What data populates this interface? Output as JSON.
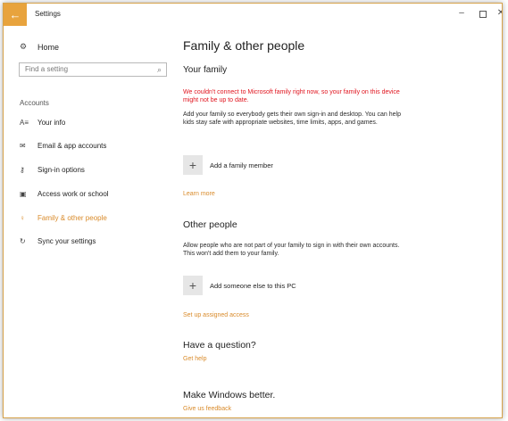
{
  "window": {
    "title": "Settings",
    "back_icon": "back-arrow-icon",
    "controls": {
      "minimize": "–",
      "maximize": "□",
      "close": "✕"
    }
  },
  "sidebar": {
    "home_label": "Home",
    "search_placeholder": "Find a setting",
    "section_label": "Accounts",
    "items": [
      {
        "label": "Your info",
        "icon": "person-card-icon",
        "active": false
      },
      {
        "label": "Email & app accounts",
        "icon": "mail-icon",
        "active": false
      },
      {
        "label": "Sign-in options",
        "icon": "key-icon",
        "active": false
      },
      {
        "label": "Access work or school",
        "icon": "briefcase-icon",
        "active": false
      },
      {
        "label": "Family & other people",
        "icon": "people-icon",
        "active": true
      },
      {
        "label": "Sync your settings",
        "icon": "sync-icon",
        "active": false
      }
    ]
  },
  "main": {
    "title": "Family & other people",
    "your_family": {
      "heading": "Your family",
      "warning": "We couldn't connect to Microsoft family right now, so your family on this device might not be up to date.",
      "description": "Add your family so everybody gets their own sign-in and desktop. You can help kids stay safe with appropriate websites, time limits, apps, and games.",
      "add_label": "Add a family member",
      "learn_more": "Learn more"
    },
    "other_people": {
      "heading": "Other people",
      "description": "Allow people who are not part of your family to sign in with their own accounts. This won't add them to your family.",
      "add_label": "Add someone else to this PC",
      "assigned_access": "Set up assigned access"
    },
    "question": {
      "heading": "Have a question?",
      "link": "Get help"
    },
    "better": {
      "heading": "Make Windows better.",
      "link": "Give us feedback"
    }
  },
  "colors": {
    "accent": "#d98b2b",
    "back_button": "#e8a33d",
    "warning": "#e0141e"
  }
}
